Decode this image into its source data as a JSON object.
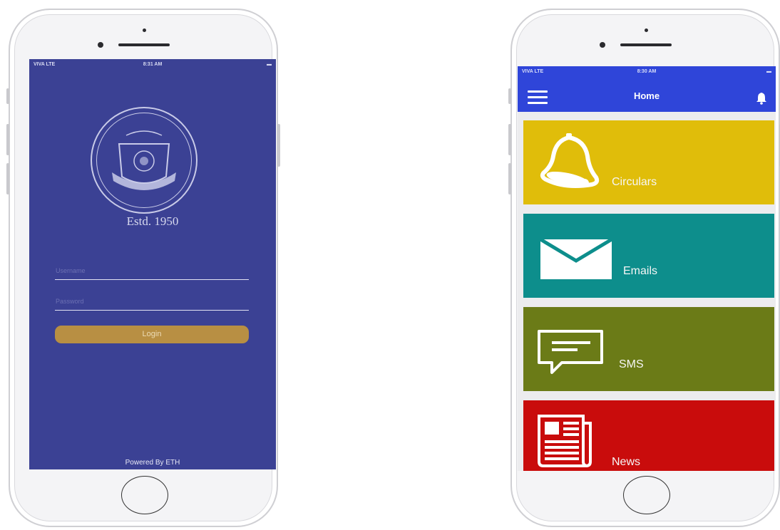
{
  "login_screen": {
    "status": {
      "carrier": "VIVA  LTE",
      "time": "8:31 AM"
    },
    "estd": "Estd. 1950",
    "username_placeholder": "Username",
    "password_placeholder": "Password",
    "login_label": "Login",
    "footer": "Powered By ETH",
    "colors": {
      "background": "#3b4194",
      "button": "#b88f43"
    }
  },
  "home_screen": {
    "status": {
      "carrier": "VIVA  LTE",
      "time": "8:30 AM"
    },
    "title": "Home",
    "tiles": [
      {
        "label": "Circulars",
        "color": "#e0bd0a",
        "icon": "bell-icon"
      },
      {
        "label": "Emails",
        "color": "#0d8e8c",
        "icon": "envelope-icon"
      },
      {
        "label": "SMS",
        "color": "#6b7b17",
        "icon": "message-icon"
      },
      {
        "label": "News",
        "color": "#c90c0c",
        "icon": "newspaper-icon"
      }
    ],
    "colors": {
      "header": "#2f45d9"
    }
  }
}
